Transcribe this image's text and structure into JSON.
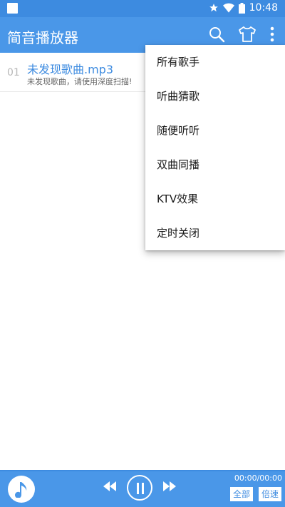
{
  "status": {
    "time": "10:48"
  },
  "app": {
    "title": "简音播放器"
  },
  "list": {
    "items": [
      {
        "index": "01",
        "title": "未发现歌曲.mp3",
        "subtitle": "未发现歌曲，请使用深度扫描!"
      }
    ]
  },
  "menu": {
    "items": [
      "所有歌手",
      "听曲猜歌",
      "随便听听",
      "双曲同播",
      "KTV效果",
      "定时关闭"
    ]
  },
  "player": {
    "time": "00:00/00:00",
    "mode_label": "全部",
    "speed_label": "倍速"
  },
  "colors": {
    "primary": "#4a97e8",
    "status_bar": "#3d8be0",
    "accent_text": "#3d8be0"
  }
}
